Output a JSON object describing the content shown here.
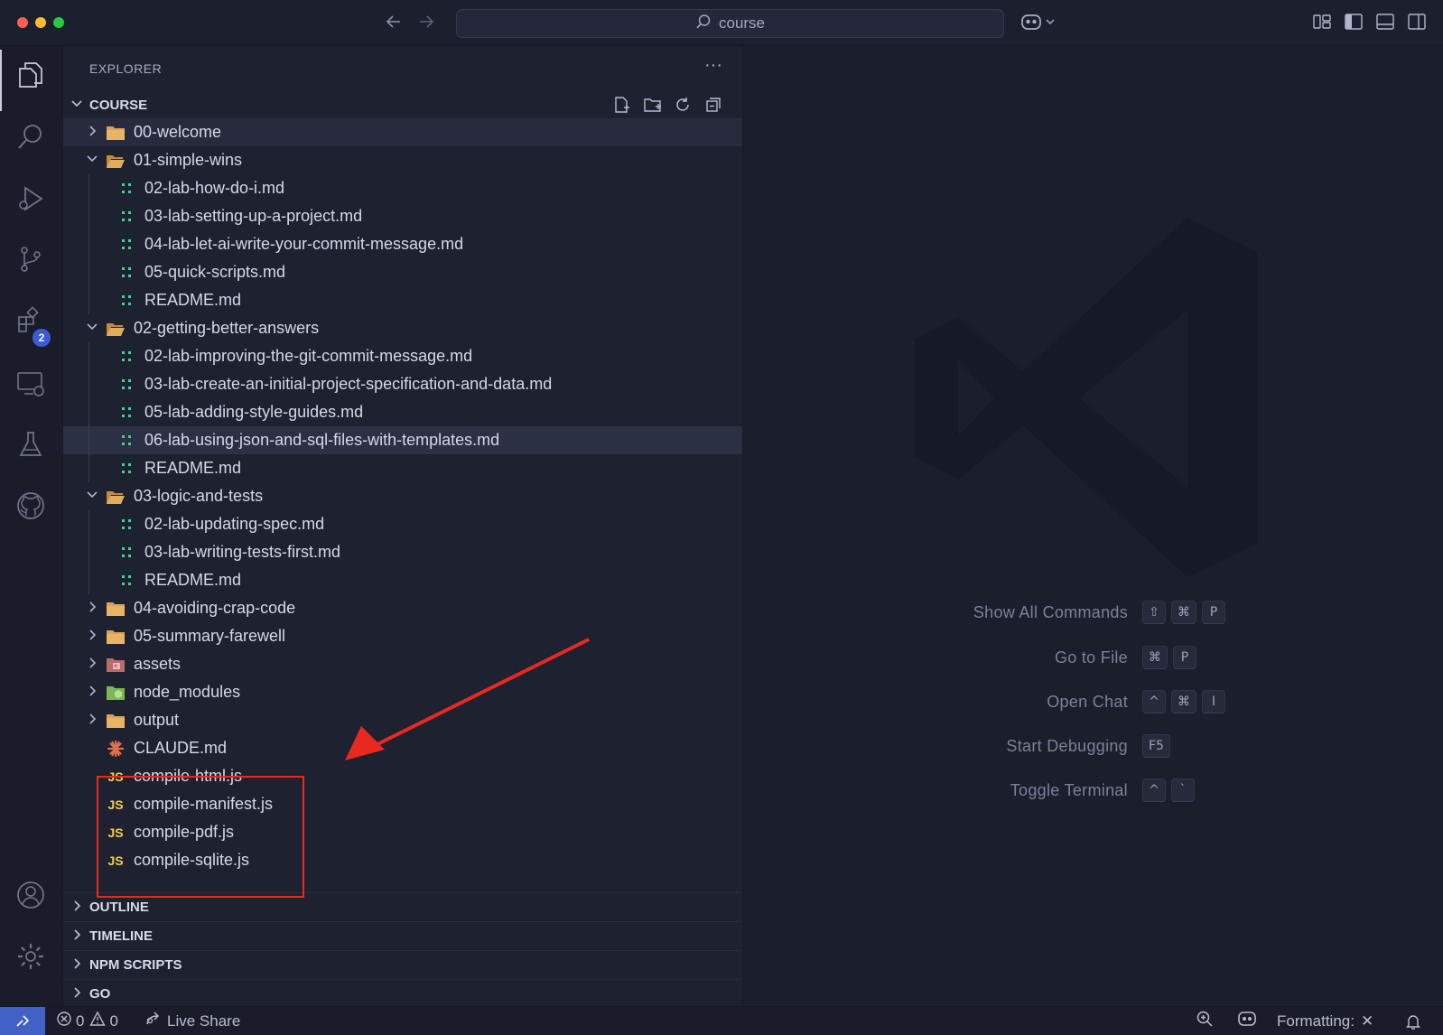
{
  "window": {
    "search_text": "course"
  },
  "explorer": {
    "title": "EXPLORER",
    "more": "···",
    "root_label": "COURSE",
    "tree": [
      {
        "type": "folder",
        "open": false,
        "label": "00-welcome",
        "depth": 0,
        "state": "hover"
      },
      {
        "type": "folder",
        "open": true,
        "label": "01-simple-wins",
        "depth": 0
      },
      {
        "type": "md",
        "label": "02-lab-how-do-i.md",
        "depth": 1
      },
      {
        "type": "md",
        "label": "03-lab-setting-up-a-project.md",
        "depth": 1
      },
      {
        "type": "md",
        "label": "04-lab-let-ai-write-your-commit-message.md",
        "depth": 1
      },
      {
        "type": "md",
        "label": "05-quick-scripts.md",
        "depth": 1
      },
      {
        "type": "md",
        "label": "README.md",
        "depth": 1
      },
      {
        "type": "folder",
        "open": true,
        "label": "02-getting-better-answers",
        "depth": 0
      },
      {
        "type": "md",
        "label": "02-lab-improving-the-git-commit-message.md",
        "depth": 1
      },
      {
        "type": "md",
        "label": "03-lab-create-an-initial-project-specification-and-data.md",
        "depth": 1
      },
      {
        "type": "md",
        "label": "05-lab-adding-style-guides.md",
        "depth": 1
      },
      {
        "type": "md",
        "label": "06-lab-using-json-and-sql-files-with-templates.md",
        "depth": 1,
        "state": "selected"
      },
      {
        "type": "md",
        "label": "README.md",
        "depth": 1
      },
      {
        "type": "folder",
        "open": true,
        "label": "03-logic-and-tests",
        "depth": 0
      },
      {
        "type": "md",
        "label": "02-lab-updating-spec.md",
        "depth": 1
      },
      {
        "type": "md",
        "label": "03-lab-writing-tests-first.md",
        "depth": 1
      },
      {
        "type": "md",
        "label": "README.md",
        "depth": 1
      },
      {
        "type": "folder",
        "open": false,
        "label": "04-avoiding-crap-code",
        "depth": 0
      },
      {
        "type": "folder",
        "open": false,
        "label": "05-summary-farewell",
        "depth": 0
      },
      {
        "type": "folder-assets",
        "open": false,
        "label": "assets",
        "depth": 0
      },
      {
        "type": "folder-node",
        "open": false,
        "label": "node_modules",
        "depth": 0
      },
      {
        "type": "folder",
        "open": false,
        "label": "output",
        "depth": 0
      },
      {
        "type": "claude",
        "label": "CLAUDE.md",
        "depth": 0
      },
      {
        "type": "js",
        "label": "compile-html.js",
        "depth": 0
      },
      {
        "type": "js",
        "label": "compile-manifest.js",
        "depth": 0
      },
      {
        "type": "js",
        "label": "compile-pdf.js",
        "depth": 0
      },
      {
        "type": "js",
        "label": "compile-sqlite.js",
        "depth": 0
      }
    ],
    "js_badge": "JS",
    "md_glyph": "⁚⁚",
    "panels": [
      "OUTLINE",
      "TIMELINE",
      "NPM SCRIPTS",
      "GO"
    ]
  },
  "activity": {
    "extensions_badge": "2"
  },
  "editor": {
    "shortcuts": [
      {
        "label": "Show All Commands",
        "keys": [
          "⇧",
          "⌘",
          "P"
        ]
      },
      {
        "label": "Go to File",
        "keys": [
          "⌘",
          "P"
        ]
      },
      {
        "label": "Open Chat",
        "keys": [
          "^",
          "⌘",
          "I"
        ]
      },
      {
        "label": "Start Debugging",
        "keys": [
          "F5"
        ]
      },
      {
        "label": "Toggle Terminal",
        "keys": [
          "^",
          "`"
        ]
      }
    ]
  },
  "status": {
    "errors": "0",
    "warnings": "0",
    "live_share": "Live Share",
    "formatting": "Formatting:",
    "formatting_icon": "✕"
  },
  "colors": {
    "accent": "#4161c7",
    "highlight_box": "#e8291f",
    "md_icon": "#39d98a",
    "js_icon": "#f2d04b",
    "folder_icon": "#d9a45a"
  }
}
